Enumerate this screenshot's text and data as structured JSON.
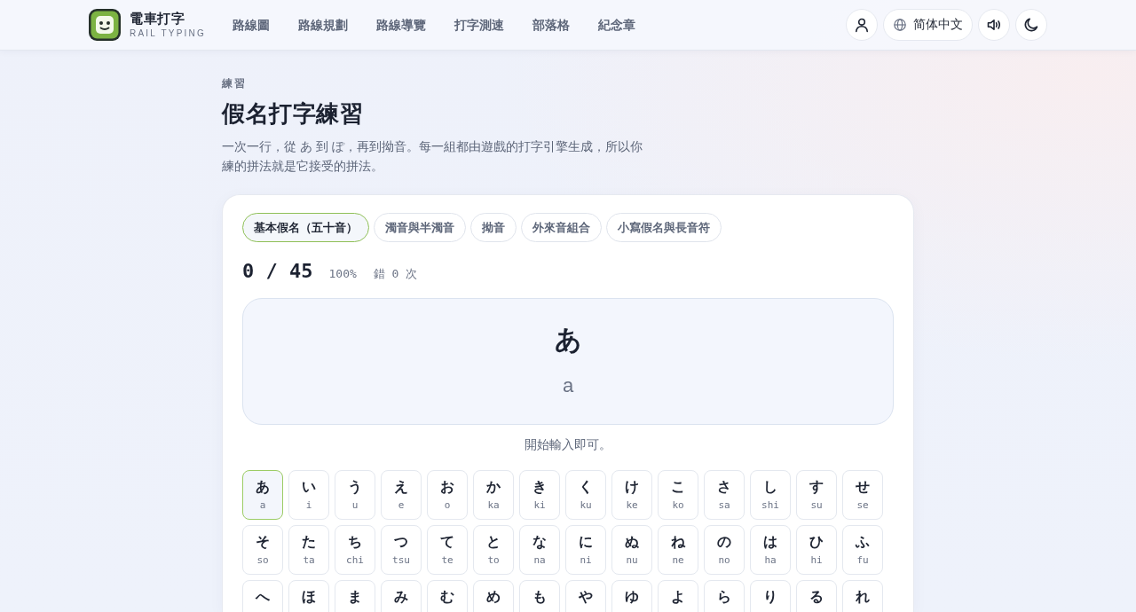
{
  "header": {
    "brand": {
      "name": "電車打字",
      "tagline": "RAIL TYPING"
    },
    "nav": [
      "路線圖",
      "路線規劃",
      "路線導覽",
      "打字測速",
      "部落格",
      "紀念章"
    ],
    "language": "简体中文"
  },
  "intro": {
    "eyebrow": "練習",
    "title": "假名打字練習",
    "description": "一次一行，從 あ 到 ぽ，再到拗音。每一組都由遊戲的打字引擎生成，所以你練的拼法就是它接受的拼法。"
  },
  "practice": {
    "tabs": [
      {
        "label": "基本假名（五十音）",
        "selected": true
      },
      {
        "label": "濁音與半濁音",
        "selected": false
      },
      {
        "label": "拗音",
        "selected": false
      },
      {
        "label": "外來音組合",
        "selected": false
      },
      {
        "label": "小寫假名與長音符",
        "selected": false
      }
    ],
    "progress": "0 / 45",
    "accuracy": "100%",
    "errors": "錯 0 次",
    "prompt": {
      "kana": "あ",
      "romaji": "a"
    },
    "hint": "開始輸入即可。",
    "kana_rows": [
      [
        {
          "kana": "あ",
          "romaji": "a",
          "current": true
        },
        {
          "kana": "い",
          "romaji": "i",
          "current": false
        },
        {
          "kana": "う",
          "romaji": "u",
          "current": false
        },
        {
          "kana": "え",
          "romaji": "e",
          "current": false
        },
        {
          "kana": "お",
          "romaji": "o",
          "current": false
        },
        {
          "kana": "か",
          "romaji": "ka",
          "current": false
        },
        {
          "kana": "き",
          "romaji": "ki",
          "current": false
        },
        {
          "kana": "く",
          "romaji": "ku",
          "current": false
        },
        {
          "kana": "け",
          "romaji": "ke",
          "current": false
        },
        {
          "kana": "こ",
          "romaji": "ko",
          "current": false
        },
        {
          "kana": "さ",
          "romaji": "sa",
          "current": false
        },
        {
          "kana": "し",
          "romaji": "shi",
          "current": false
        },
        {
          "kana": "す",
          "romaji": "su",
          "current": false
        },
        {
          "kana": "せ",
          "romaji": "se",
          "current": false
        }
      ],
      [
        {
          "kana": "そ",
          "romaji": "so",
          "current": false
        },
        {
          "kana": "た",
          "romaji": "ta",
          "current": false
        },
        {
          "kana": "ち",
          "romaji": "chi",
          "current": false
        },
        {
          "kana": "つ",
          "romaji": "tsu",
          "current": false
        },
        {
          "kana": "て",
          "romaji": "te",
          "current": false
        },
        {
          "kana": "と",
          "romaji": "to",
          "current": false
        },
        {
          "kana": "な",
          "romaji": "na",
          "current": false
        },
        {
          "kana": "に",
          "romaji": "ni",
          "current": false
        },
        {
          "kana": "ぬ",
          "romaji": "nu",
          "current": false
        },
        {
          "kana": "ね",
          "romaji": "ne",
          "current": false
        },
        {
          "kana": "の",
          "romaji": "no",
          "current": false
        },
        {
          "kana": "は",
          "romaji": "ha",
          "current": false
        },
        {
          "kana": "ひ",
          "romaji": "hi",
          "current": false
        },
        {
          "kana": "ふ",
          "romaji": "fu",
          "current": false
        }
      ],
      [
        {
          "kana": "へ",
          "current": false
        },
        {
          "kana": "ほ",
          "current": false
        },
        {
          "kana": "ま",
          "current": false
        },
        {
          "kana": "み",
          "current": false
        },
        {
          "kana": "む",
          "current": false
        },
        {
          "kana": "め",
          "current": false
        },
        {
          "kana": "も",
          "current": false
        },
        {
          "kana": "や",
          "current": false
        },
        {
          "kana": "ゆ",
          "current": false
        },
        {
          "kana": "よ",
          "current": false
        },
        {
          "kana": "ら",
          "current": false
        },
        {
          "kana": "り",
          "current": false
        },
        {
          "kana": "る",
          "current": false
        },
        {
          "kana": "れ",
          "current": false
        }
      ]
    ]
  }
}
